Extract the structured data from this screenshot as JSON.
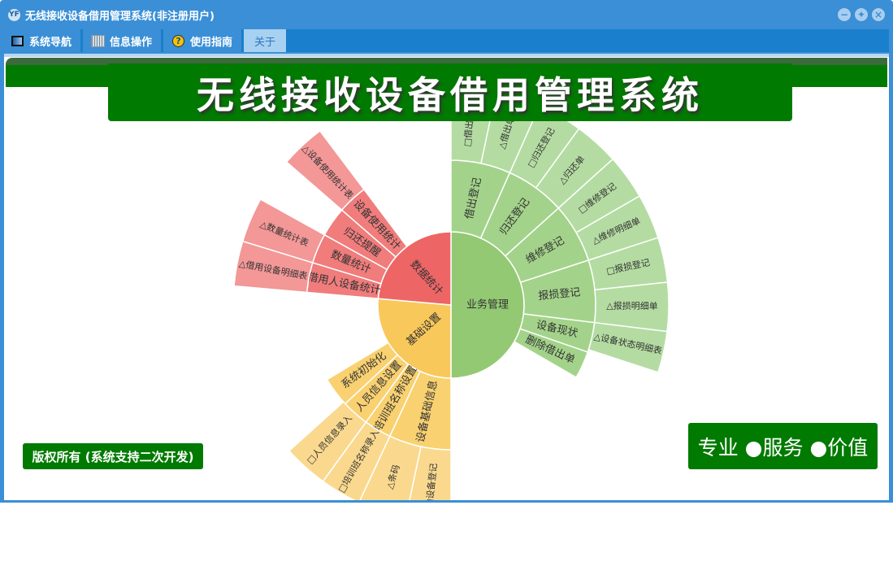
{
  "window": {
    "title": "无线接收设备借用管理系统(非注册用户)",
    "app_icon": "yf-logo-icon"
  },
  "menu": {
    "tabs": [
      {
        "label": "系统导航",
        "icon": "monitor-icon"
      },
      {
        "label": "信息操作",
        "icon": "grid-icon"
      },
      {
        "label": "使用指南",
        "icon": "help-icon"
      },
      {
        "label": "关于",
        "active": true
      }
    ]
  },
  "banner": {
    "title": "无线接收设备借用管理系统"
  },
  "footer": {
    "copyright": "版权所有 (系统支持二次开发)",
    "slogan": "专业 ●服务 ●价值"
  },
  "colors": {
    "green": [
      "#94c973",
      "#a3d38a",
      "#b4dca2"
    ],
    "red": [
      "#ee6566",
      "#f07c7c",
      "#f39797"
    ],
    "yellow": [
      "#f9c85a",
      "#f9d170",
      "#fad98e"
    ]
  },
  "chart_data": {
    "type": "sunburst",
    "nodes": [
      {
        "name": "业务管理",
        "color": "green",
        "start": 0,
        "end": 180,
        "children": [
          {
            "name": "借出登记",
            "start": 0,
            "end": 24,
            "children": [
              {
                "name": "□借出登记",
                "start": 0,
                "end": 12
              },
              {
                "name": "△借出单",
                "start": 12,
                "end": 24
              }
            ]
          },
          {
            "name": "归还登记",
            "start": 24,
            "end": 48,
            "children": [
              {
                "name": "□归还登记",
                "start": 24,
                "end": 36
              },
              {
                "name": "△归还单",
                "start": 36,
                "end": 48
              }
            ]
          },
          {
            "name": "维修登记",
            "start": 48,
            "end": 72,
            "children": [
              {
                "name": "□维修登记",
                "start": 48,
                "end": 60
              },
              {
                "name": "△维修明细单",
                "start": 60,
                "end": 72
              }
            ]
          },
          {
            "name": "报损登记",
            "start": 72,
            "end": 97,
            "children": [
              {
                "name": "□报损登记",
                "start": 72,
                "end": 84
              },
              {
                "name": "△报损明细单",
                "start": 84,
                "end": 97
              }
            ]
          },
          {
            "name": "设备现状",
            "start": 97,
            "end": 109,
            "children": [
              {
                "name": "△设备状态明细表",
                "start": 97,
                "end": 108
              }
            ]
          },
          {
            "name": "删除借出单",
            "start": 109,
            "end": 120,
            "children": []
          }
        ]
      },
      {
        "name": "基础设置",
        "color": "yellow",
        "start": 180,
        "end": 275,
        "children": [
          {
            "name": "设备基础信息",
            "start": 180,
            "end": 205,
            "children": [
              {
                "name": "□设备登记",
                "start": 180,
                "end": 192
              },
              {
                "name": "△条码",
                "start": 192,
                "end": 205
              }
            ]
          },
          {
            "name": "培训班名称设置",
            "start": 205,
            "end": 216,
            "children": [
              {
                "name": "□培训班名称录入",
                "start": 205,
                "end": 216
              }
            ]
          },
          {
            "name": "人员信息设置",
            "start": 216,
            "end": 227,
            "children": [
              {
                "name": "□人员信息录入",
                "start": 216,
                "end": 228
              }
            ]
          },
          {
            "name": "系统初始化",
            "start": 227,
            "end": 239,
            "children": []
          }
        ]
      },
      {
        "name": "数据统计",
        "color": "red",
        "start": 275,
        "end": 360,
        "children": [
          {
            "name": "借用人设备统计",
            "start": 275,
            "end": 287,
            "children": [
              {
                "name": "△借用设备明细表",
                "start": 275,
                "end": 287
              }
            ]
          },
          {
            "name": "数量统计",
            "start": 287,
            "end": 299,
            "children": [
              {
                "name": "△数量统计表",
                "start": 287,
                "end": 299
              }
            ]
          },
          {
            "name": "归还提醒",
            "start": 299,
            "end": 311,
            "children": []
          },
          {
            "name": "设备使用统计",
            "start": 311,
            "end": 323,
            "children": [
              {
                "name": "△设备使用统计表",
                "start": 311,
                "end": 323
              }
            ]
          }
        ]
      }
    ]
  }
}
